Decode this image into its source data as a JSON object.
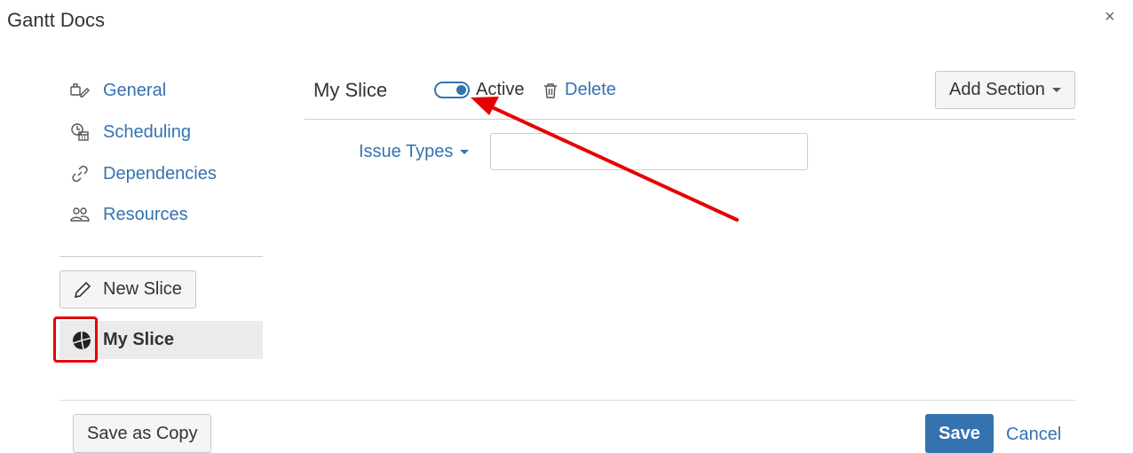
{
  "dialog": {
    "title": "Gantt Docs",
    "close": "×"
  },
  "nav": {
    "items": [
      {
        "label": "General",
        "icon": "settings-edit-icon"
      },
      {
        "label": "Scheduling",
        "icon": "calendar-clock-icon"
      },
      {
        "label": "Dependencies",
        "icon": "link-icon"
      },
      {
        "label": "Resources",
        "icon": "people-icon"
      }
    ]
  },
  "slices": {
    "new_label": "New Slice",
    "items": [
      {
        "label": "My Slice",
        "icon": "pie-chart-icon",
        "selected": true
      }
    ]
  },
  "editor": {
    "title": "My Slice",
    "active_label": "Active",
    "active": true,
    "delete_label": "Delete",
    "add_section_label": "Add Section",
    "issue_types_label": "Issue Types",
    "issue_types_value": ""
  },
  "footer": {
    "save_copy_label": "Save as Copy",
    "save_label": "Save",
    "cancel_label": "Cancel"
  },
  "colors": {
    "link": "#3572b0",
    "primary": "#3572b0",
    "annotation": "#e60000"
  }
}
